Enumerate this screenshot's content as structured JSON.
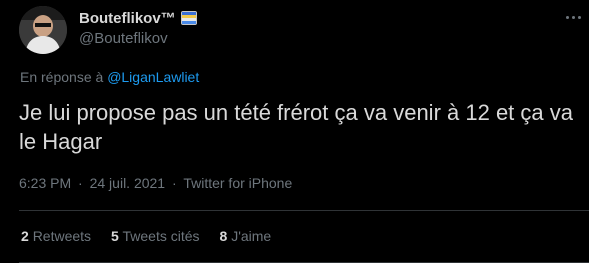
{
  "user": {
    "display_name": "Bouteflikov™",
    "handle": "@Bouteflikov"
  },
  "reply": {
    "prefix": "En réponse à",
    "mention": "@LiganLawliet"
  },
  "tweet": {
    "text": "Je lui propose pas un tété frérot ça va venir à 12 et ça va le Hagar"
  },
  "meta": {
    "time": "6:23 PM",
    "separator": "·",
    "date": "24 juil. 2021",
    "source": "Twitter for iPhone"
  },
  "stats": [
    {
      "count": "2",
      "label": "Retweets"
    },
    {
      "count": "5",
      "label": "Tweets cités"
    },
    {
      "count": "8",
      "label": "J'aime"
    }
  ],
  "colors": {
    "background": "#000000",
    "text": "#d9d9d9",
    "muted": "#6e767d",
    "link": "#1d9bf0",
    "divider": "#2f3336"
  },
  "icons": {
    "more": "more-horizontal-icon",
    "badge": "flag-emoji-icon"
  }
}
